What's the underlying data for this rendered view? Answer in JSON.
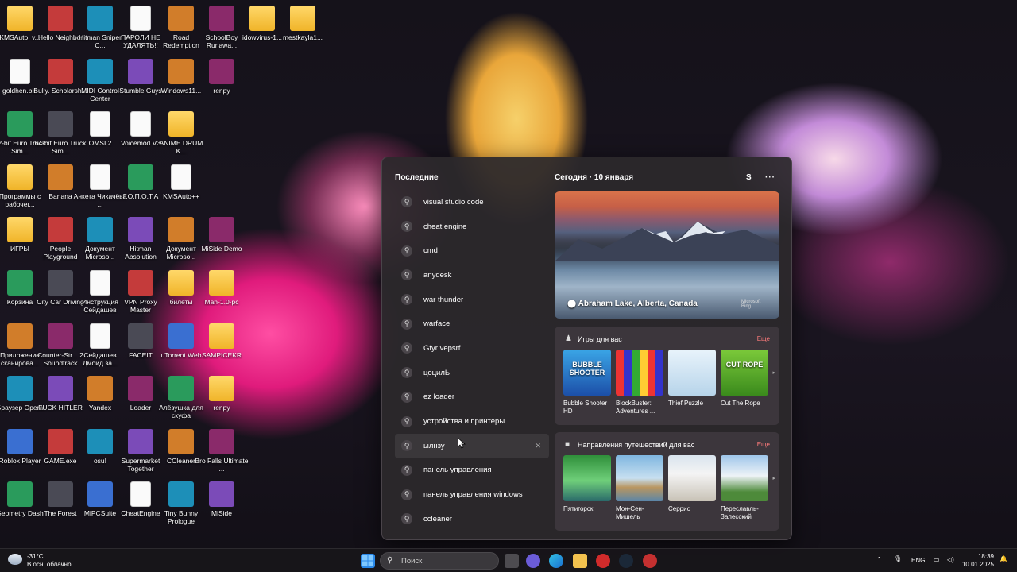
{
  "desktop": {
    "icons": [
      {
        "label": "KMSAuto_v...",
        "kind": "folder"
      },
      {
        "label": "Hello Neighbor",
        "kind": "app"
      },
      {
        "label": "Hitman Sniper C...",
        "kind": "app"
      },
      {
        "label": "ПАРОЛИ НЕ УДАЛЯТЬ!!",
        "kind": "file"
      },
      {
        "label": "Road Redemption",
        "kind": "app"
      },
      {
        "label": "SchoolBoy Runawa...",
        "kind": "app"
      },
      {
        "label": "idowvirus-1...",
        "kind": "folder"
      },
      {
        "label": "mestkayla1...",
        "kind": "folder"
      },
      {
        "label": "goldhen.bin",
        "kind": "file"
      },
      {
        "label": "Bully. Scholarsh...",
        "kind": "app"
      },
      {
        "label": "MIDI Control Center",
        "kind": "app"
      },
      {
        "label": "Stumble Guys",
        "kind": "app"
      },
      {
        "label": "Windows11...",
        "kind": "app"
      },
      {
        "label": "renpy",
        "kind": "app"
      },
      {
        "label": "32-bit Euro Truck Sim...",
        "kind": "app"
      },
      {
        "label": "64-bit Euro Truck Sim...",
        "kind": "app"
      },
      {
        "label": "OMSI 2",
        "kind": "file"
      },
      {
        "label": "Voicemod V3",
        "kind": "file"
      },
      {
        "label": "ANIME DRUM K...",
        "kind": "folder"
      },
      {
        "label": "Программы с рабочег...",
        "kind": "folder"
      },
      {
        "label": "Banana",
        "kind": "app"
      },
      {
        "label": "Анкета Чикачёва ...",
        "kind": "file"
      },
      {
        "label": "Г.О.П.О.Т.А",
        "kind": "app"
      },
      {
        "label": "KMSAuto++",
        "kind": "file"
      },
      {
        "label": "ИГРЫ",
        "kind": "folder"
      },
      {
        "label": "People Playground",
        "kind": "app"
      },
      {
        "label": "Документ Microso...",
        "kind": "app"
      },
      {
        "label": "Hitman Absolution",
        "kind": "app"
      },
      {
        "label": "Документ Microso...",
        "kind": "app"
      },
      {
        "label": "MiSide Demo",
        "kind": "app"
      },
      {
        "label": "Корзина",
        "kind": "app"
      },
      {
        "label": "City Car Driving",
        "kind": "app"
      },
      {
        "label": "Инструкция Сейдашев",
        "kind": "file"
      },
      {
        "label": "VPN Proxy Master",
        "kind": "app"
      },
      {
        "label": "билеты",
        "kind": "folder"
      },
      {
        "label": "Mah-1.0-pc",
        "kind": "folder"
      },
      {
        "label": "Приложение сканирова...",
        "kind": "app"
      },
      {
        "label": "Counter-Str... 2 Soundtrack",
        "kind": "app"
      },
      {
        "label": "Сейдашев Дмоид за...",
        "kind": "file"
      },
      {
        "label": "FACEIT",
        "kind": "app"
      },
      {
        "label": "uTorrent Web",
        "kind": "app"
      },
      {
        "label": "SAMPICEKR",
        "kind": "folder"
      },
      {
        "label": "Браузер Opera",
        "kind": "app"
      },
      {
        "label": "FUCK HITLER",
        "kind": "app"
      },
      {
        "label": "Yandex",
        "kind": "app"
      },
      {
        "label": "Loader",
        "kind": "app"
      },
      {
        "label": "Алёзушка для скуфа",
        "kind": "app"
      },
      {
        "label": "renpy",
        "kind": "folder"
      },
      {
        "label": "Roblox Player",
        "kind": "app"
      },
      {
        "label": "GAME.exe",
        "kind": "app"
      },
      {
        "label": "osu!",
        "kind": "app"
      },
      {
        "label": "Supermarket Together",
        "kind": "app"
      },
      {
        "label": "CCleaner",
        "kind": "app"
      },
      {
        "label": "Bro Falls Ultimate ...",
        "kind": "app"
      },
      {
        "label": "Geometry Dash",
        "kind": "app"
      },
      {
        "label": "The Forest",
        "kind": "app"
      },
      {
        "label": "MiPCSuite",
        "kind": "app"
      },
      {
        "label": "CheatEngine",
        "kind": "file"
      },
      {
        "label": "Tiny Bunny Prologue",
        "kind": "app"
      },
      {
        "label": "MiSide",
        "kind": "app"
      }
    ]
  },
  "search_panel": {
    "recent_header": "Последние",
    "recent": [
      "visual studio code",
      "cheat engine",
      "cmd",
      "anydesk",
      "war thunder",
      "warface",
      "Gfyr vepsrf",
      "цоцилЬ",
      "ez loader",
      "устройства и принтеры",
      "ылнзу",
      "панель управления",
      "панель управления windows",
      "ccleaner"
    ],
    "today_label": "Сегодня",
    "date": "10 января",
    "user_initial": "S",
    "more_menu": "···",
    "hero_location": "Abraham Lake, Alberta, Canada",
    "hero_brand": "Microsoft Bing",
    "games": {
      "title": "Игры для вас",
      "more": "Еще",
      "items": [
        "Bubble Shooter HD",
        "BlockBuster: Adventures ...",
        "Thief Puzzle",
        "Cut The Rope"
      ],
      "art": [
        "BUBBLE SHOOTER",
        "",
        "",
        "CUT ROPE"
      ]
    },
    "travel": {
      "title": "Направления путешествий для вас",
      "more": "Еще",
      "items": [
        "Пятигорск",
        "Мон-Сен-Мишель",
        "Серрис",
        "Переславль-Залесский"
      ]
    }
  },
  "taskbar": {
    "weather_temp": "-31°C",
    "weather_desc": "В осн. облачно",
    "search_placeholder": "Поиск",
    "lang": "ENG",
    "time": "18:39",
    "date": "10.01.2025"
  }
}
